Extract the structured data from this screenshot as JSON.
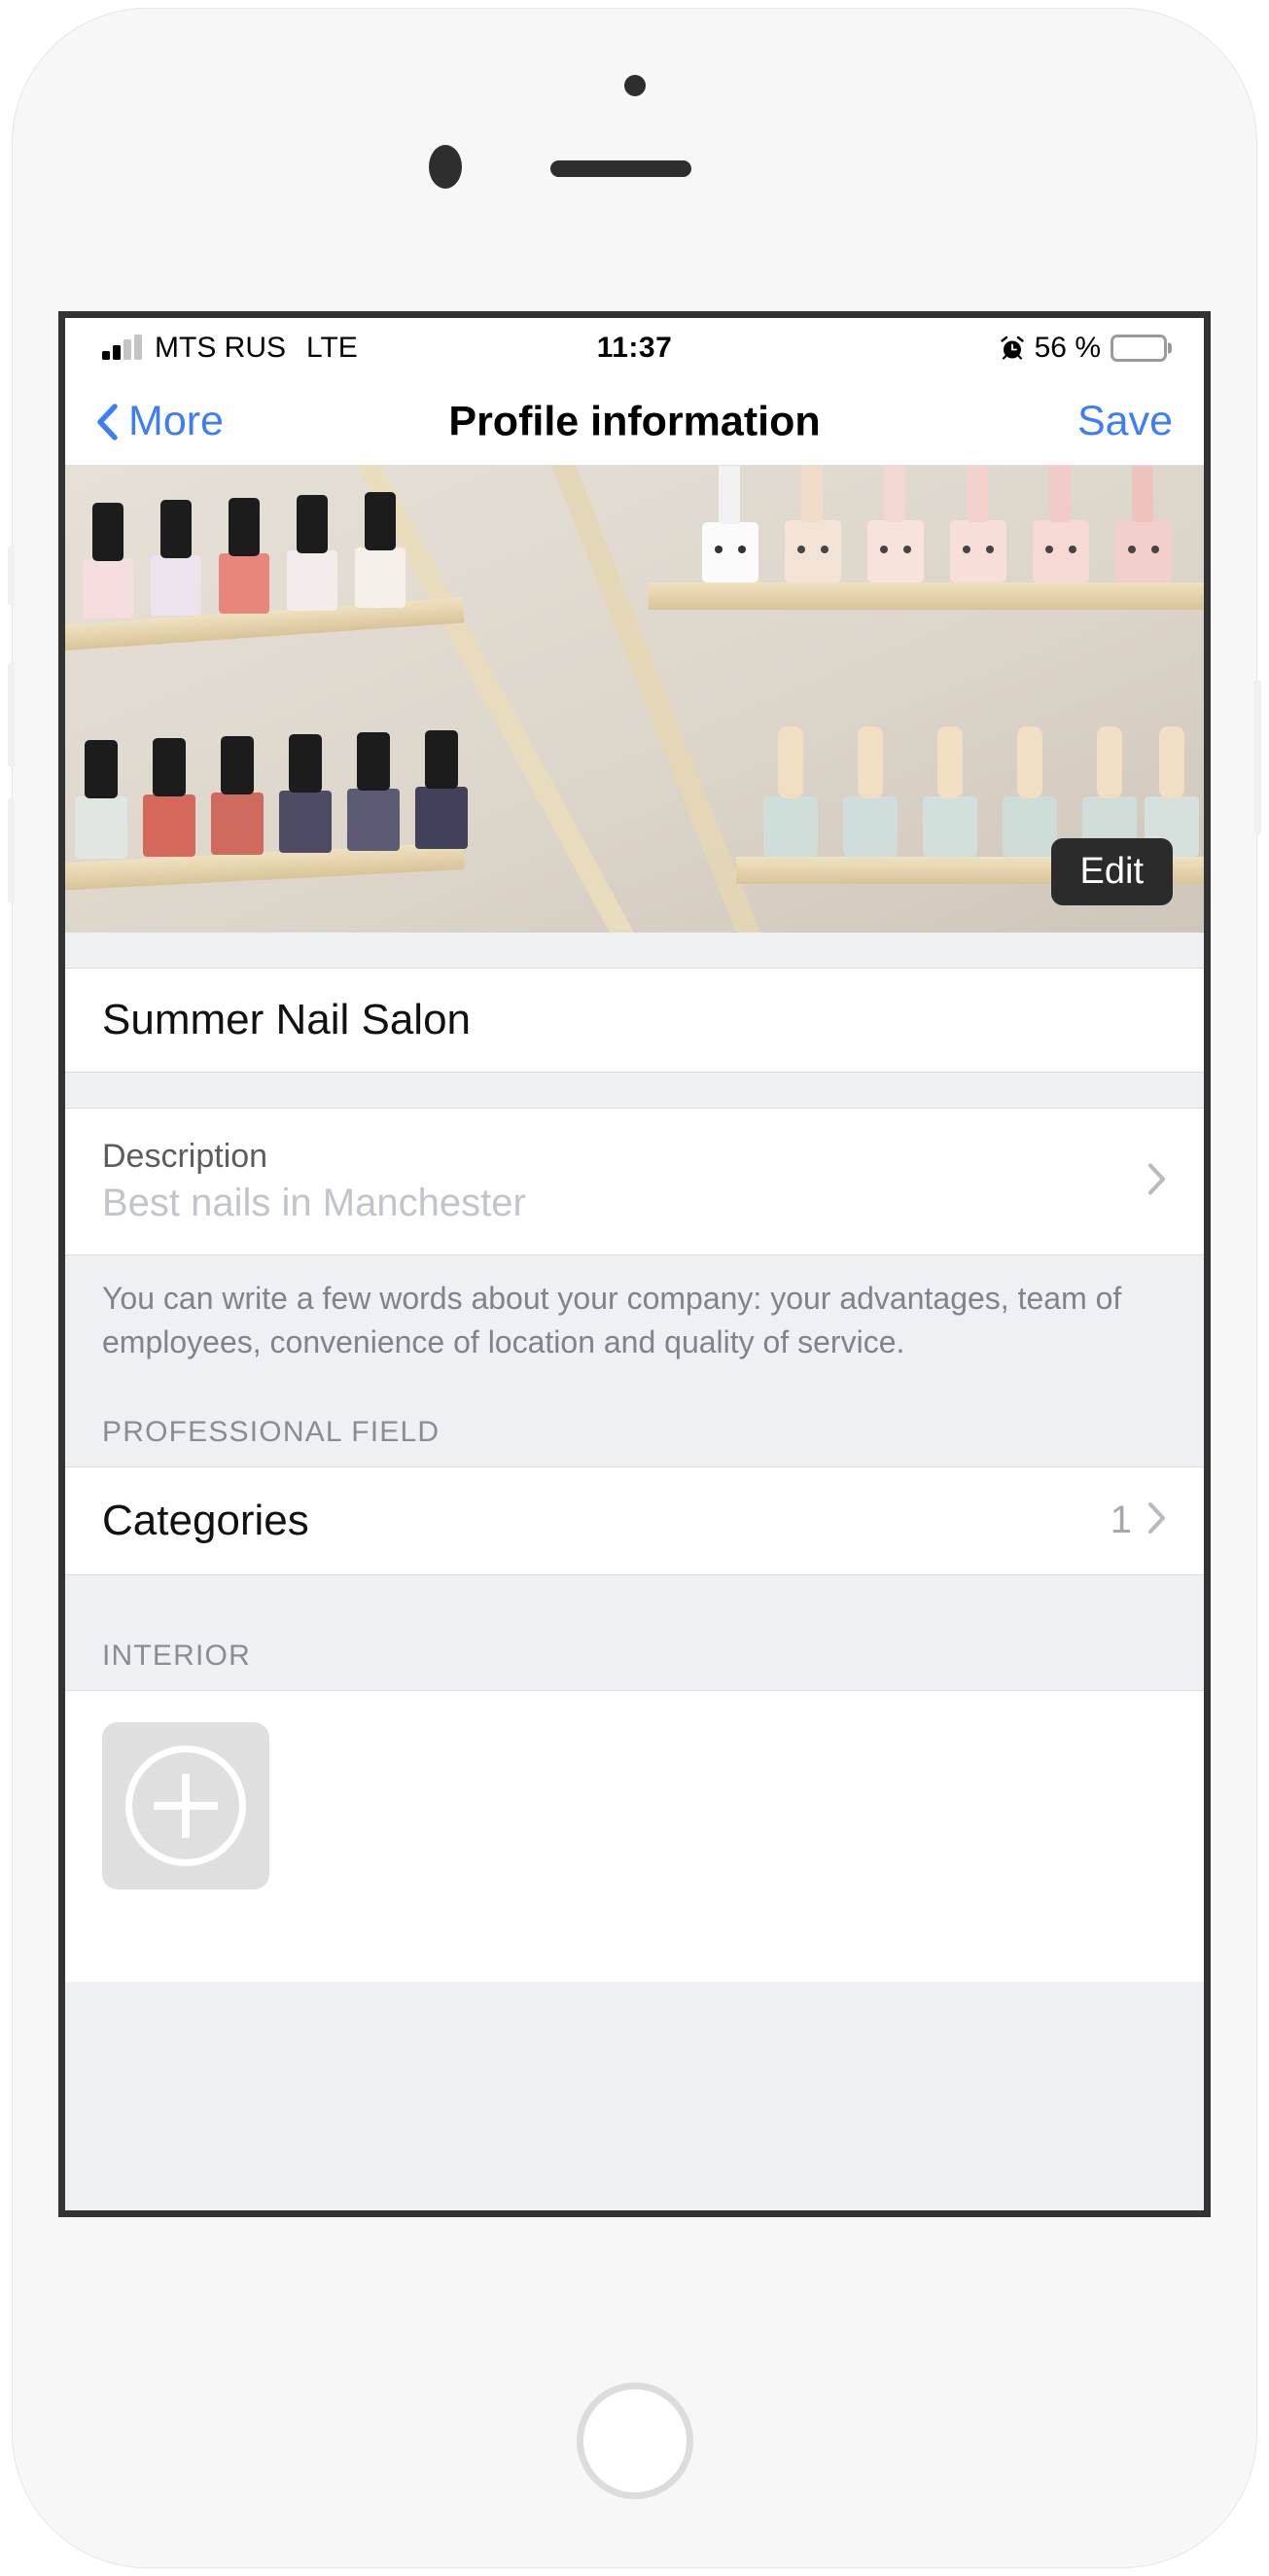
{
  "status_bar": {
    "carrier": "MTS RUS",
    "network": "LTE",
    "time": "11:37",
    "battery_text": "56 %",
    "battery_percent": 56,
    "alarm_icon": "alarm-clock-icon",
    "signal_icon": "signal-bars-icon"
  },
  "nav_bar": {
    "back_label": "More",
    "back_icon": "chevron-left-icon",
    "title": "Profile information",
    "save_label": "Save",
    "accent_color": "#3d7ef7"
  },
  "hero": {
    "edit_label": "Edit",
    "photo_alt": "nail-polish-shelves-photo"
  },
  "profile": {
    "name_value": "Summer Nail Salon",
    "description_label": "Description",
    "description_placeholder": "Best nails in Manchester",
    "description_chevron_icon": "chevron-right-icon",
    "helper_text": "You can write a few words about your company: your advantages, team of employees, convenience of location and quality of service."
  },
  "professional_field": {
    "section_title": "PROFESSIONAL FIELD",
    "categories_label": "Categories",
    "categories_count": "1",
    "categories_chevron_icon": "chevron-right-icon"
  },
  "interior": {
    "section_title": "INTERIOR",
    "add_photo_icon": "plus-circle-icon"
  }
}
